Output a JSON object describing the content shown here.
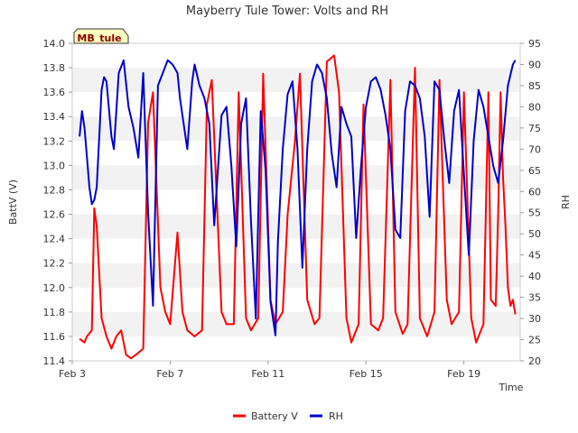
{
  "chart_data": {
    "type": "line",
    "title": "Mayberry Tule Tower: Volts and RH",
    "station_label": "MB_tule",
    "xlabel": "Time",
    "ylabel_left": "BattV (V)",
    "ylabel_right": "RH",
    "x_ticks": [
      "Feb 3",
      "Feb 7",
      "Feb 11",
      "Feb 15",
      "Feb 19"
    ],
    "x_tick_days": [
      3,
      7,
      11,
      15,
      19
    ],
    "xlim_days": [
      3,
      21.3
    ],
    "ylim_left": [
      11.4,
      14.0
    ],
    "yticks_left": [
      "11.4",
      "11.6",
      "11.8",
      "12.0",
      "12.2",
      "12.4",
      "12.6",
      "12.8",
      "13.0",
      "13.2",
      "13.4",
      "13.6",
      "13.8",
      "14.0"
    ],
    "ylim_right": [
      20,
      95
    ],
    "yticks_right": [
      "20",
      "25",
      "30",
      "35",
      "40",
      "45",
      "50",
      "55",
      "60",
      "65",
      "70",
      "75",
      "80",
      "85",
      "90",
      "95"
    ],
    "grid": "alternating horizontal bands",
    "legend_position": "bottom-center",
    "series": [
      {
        "name": "Battery V",
        "color": "#ff0000",
        "axis": "left",
        "x": [
          3.3,
          3.5,
          3.6,
          3.8,
          3.9,
          4.0,
          4.2,
          4.4,
          4.6,
          4.8,
          5.0,
          5.2,
          5.4,
          5.6,
          5.9,
          6.1,
          6.3,
          6.6,
          6.8,
          7.0,
          7.3,
          7.5,
          7.7,
          8.0,
          8.3,
          8.5,
          8.7,
          9.1,
          9.3,
          9.6,
          9.8,
          10.1,
          10.3,
          10.6,
          10.8,
          11.1,
          11.3,
          11.6,
          11.8,
          12.1,
          12.3,
          12.6,
          12.9,
          13.1,
          13.4,
          13.7,
          13.9,
          14.2,
          14.4,
          14.7,
          14.9,
          15.2,
          15.5,
          15.7,
          16.0,
          16.2,
          16.5,
          16.7,
          17.0,
          17.2,
          17.5,
          17.8,
          18.0,
          18.3,
          18.5,
          18.8,
          19.0,
          19.3,
          19.5,
          19.8,
          20.0,
          20.1,
          20.3,
          20.4,
          20.5,
          20.6,
          20.7,
          20.8,
          20.9,
          21.0,
          21.1
        ],
        "y": [
          11.58,
          11.55,
          11.6,
          11.65,
          12.65,
          12.5,
          11.75,
          11.6,
          11.5,
          11.6,
          11.65,
          11.45,
          11.42,
          11.45,
          11.5,
          13.35,
          13.6,
          12.0,
          11.8,
          11.7,
          12.45,
          11.8,
          11.65,
          11.6,
          11.65,
          13.5,
          13.7,
          11.8,
          11.7,
          11.7,
          13.6,
          11.75,
          11.65,
          11.75,
          13.75,
          11.9,
          11.7,
          11.8,
          12.6,
          13.2,
          13.75,
          11.9,
          11.7,
          11.75,
          13.85,
          13.9,
          13.6,
          11.75,
          11.55,
          11.7,
          13.5,
          11.7,
          11.65,
          11.75,
          13.7,
          11.8,
          11.62,
          11.7,
          13.8,
          11.75,
          11.6,
          11.8,
          13.7,
          11.9,
          11.7,
          11.8,
          13.6,
          11.75,
          11.55,
          11.7,
          13.6,
          11.9,
          11.85,
          12.6,
          13.6,
          12.9,
          12.5,
          12.0,
          11.85,
          11.9,
          11.78
        ]
      },
      {
        "name": "RH",
        "color": "#0000cc",
        "axis": "right",
        "x": [
          3.3,
          3.4,
          3.5,
          3.6,
          3.7,
          3.8,
          3.9,
          4.0,
          4.2,
          4.3,
          4.4,
          4.6,
          4.7,
          4.9,
          5.1,
          5.3,
          5.5,
          5.7,
          5.9,
          6.1,
          6.3,
          6.5,
          6.7,
          6.9,
          7.1,
          7.3,
          7.4,
          7.6,
          7.7,
          7.9,
          8.0,
          8.2,
          8.4,
          8.6,
          8.8,
          9.1,
          9.3,
          9.5,
          9.7,
          9.9,
          10.1,
          10.3,
          10.5,
          10.7,
          10.9,
          11.1,
          11.3,
          11.4,
          11.6,
          11.8,
          12.0,
          12.2,
          12.4,
          12.6,
          12.8,
          13.0,
          13.2,
          13.4,
          13.6,
          13.8,
          14.0,
          14.2,
          14.4,
          14.6,
          14.8,
          15.0,
          15.2,
          15.4,
          15.6,
          15.8,
          16.0,
          16.2,
          16.4,
          16.6,
          16.8,
          17.0,
          17.2,
          17.4,
          17.6,
          17.8,
          18.0,
          18.2,
          18.4,
          18.6,
          18.8,
          19.0,
          19.2,
          19.4,
          19.6,
          19.8,
          20.0,
          20.2,
          20.4,
          20.6,
          20.8,
          21.0,
          21.1
        ],
        "y": [
          73,
          79,
          75,
          68,
          61,
          57,
          58,
          61,
          84,
          87,
          86,
          73,
          70,
          88,
          91,
          80,
          75,
          68,
          88,
          55,
          33,
          85,
          88,
          91,
          90,
          88,
          82,
          74,
          70,
          86,
          90,
          85,
          82,
          76,
          52,
          78,
          80,
          66,
          47,
          76,
          82,
          53,
          30,
          79,
          65,
          34,
          26,
          48,
          70,
          83,
          86,
          70,
          42,
          70,
          86,
          90,
          88,
          82,
          69,
          61,
          80,
          76,
          73,
          49,
          66,
          80,
          86,
          87,
          84,
          78,
          70,
          51,
          49,
          79,
          86,
          85,
          82,
          73,
          54,
          86,
          84,
          72,
          62,
          79,
          84,
          64,
          45,
          72,
          84,
          80,
          73,
          66,
          62,
          72,
          85,
          90,
          91
        ]
      }
    ]
  },
  "legend": {
    "battery_label": "Battery V",
    "rh_label": "RH"
  }
}
